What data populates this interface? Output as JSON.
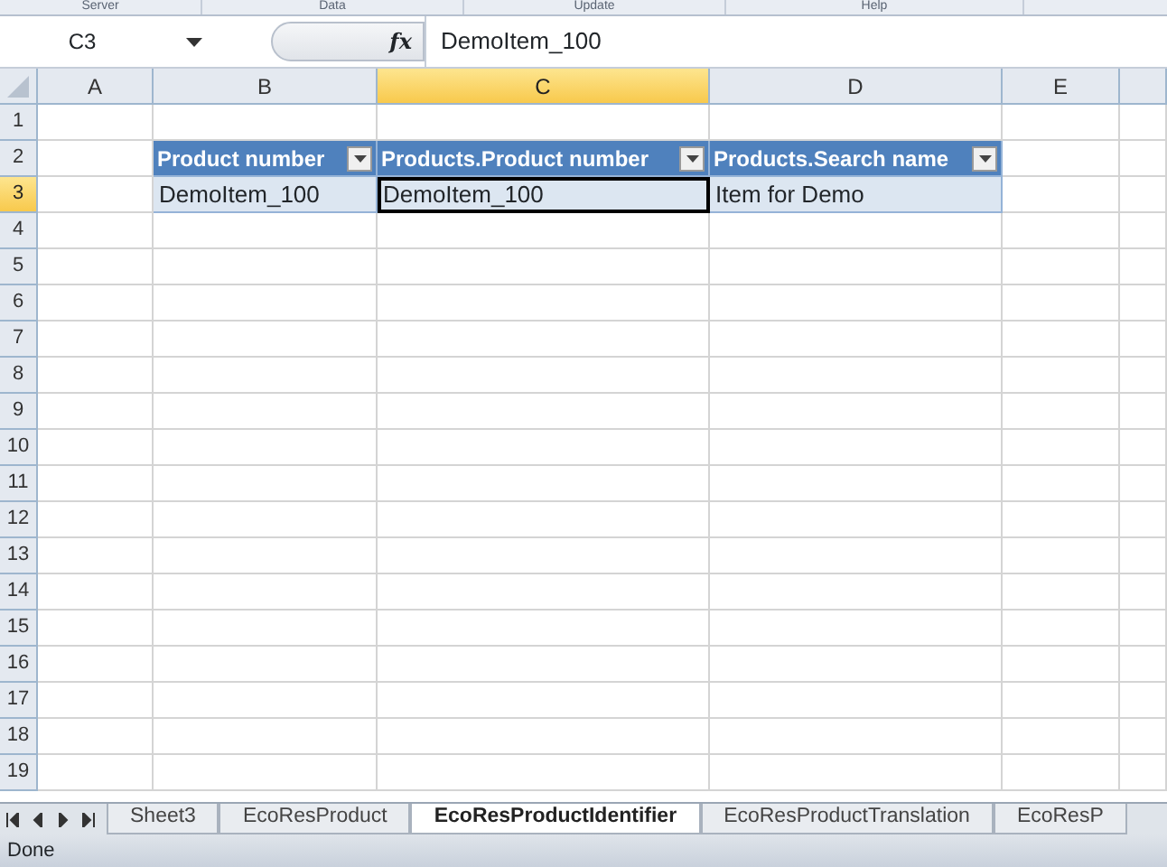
{
  "ribbon_groups": [
    "Server",
    "Data",
    "Update",
    "Help"
  ],
  "formula_bar": {
    "name_box": "C3",
    "function_label": "fx",
    "value": "DemoItem_100"
  },
  "columns": [
    {
      "label": "A",
      "selected": false
    },
    {
      "label": "B",
      "selected": false
    },
    {
      "label": "C",
      "selected": true
    },
    {
      "label": "D",
      "selected": false
    },
    {
      "label": "E",
      "selected": false
    }
  ],
  "row_numbers": [
    {
      "label": "1",
      "selected": false
    },
    {
      "label": "2",
      "selected": false
    },
    {
      "label": "3",
      "selected": true
    },
    {
      "label": "4",
      "selected": false
    },
    {
      "label": "5",
      "selected": false
    },
    {
      "label": "6",
      "selected": false
    },
    {
      "label": "7",
      "selected": false
    },
    {
      "label": "8",
      "selected": false
    },
    {
      "label": "9",
      "selected": false
    },
    {
      "label": "10",
      "selected": false
    },
    {
      "label": "11",
      "selected": false
    },
    {
      "label": "12",
      "selected": false
    },
    {
      "label": "13",
      "selected": false
    },
    {
      "label": "14",
      "selected": false
    },
    {
      "label": "15",
      "selected": false
    },
    {
      "label": "16",
      "selected": false
    },
    {
      "label": "17",
      "selected": false
    },
    {
      "label": "18",
      "selected": false
    },
    {
      "label": "19",
      "selected": false
    }
  ],
  "table": {
    "headers": [
      "Product number",
      "Products.Product number",
      "Products.Search name"
    ],
    "rows": [
      {
        "cells": [
          {
            "text": "DemoItem_100",
            "active": false
          },
          {
            "text": "DemoItem_100",
            "active": true
          },
          {
            "text": "Item for Demo",
            "active": false
          }
        ]
      }
    ]
  },
  "sheet_tabs": [
    {
      "label": "Sheet3",
      "selected": false
    },
    {
      "label": "EcoResProduct",
      "selected": false
    },
    {
      "label": "EcoResProductIdentifier",
      "selected": true
    },
    {
      "label": "EcoResProductTranslation",
      "selected": false
    },
    {
      "label": "EcoResP",
      "selected": false
    }
  ],
  "status_bar": "Done"
}
